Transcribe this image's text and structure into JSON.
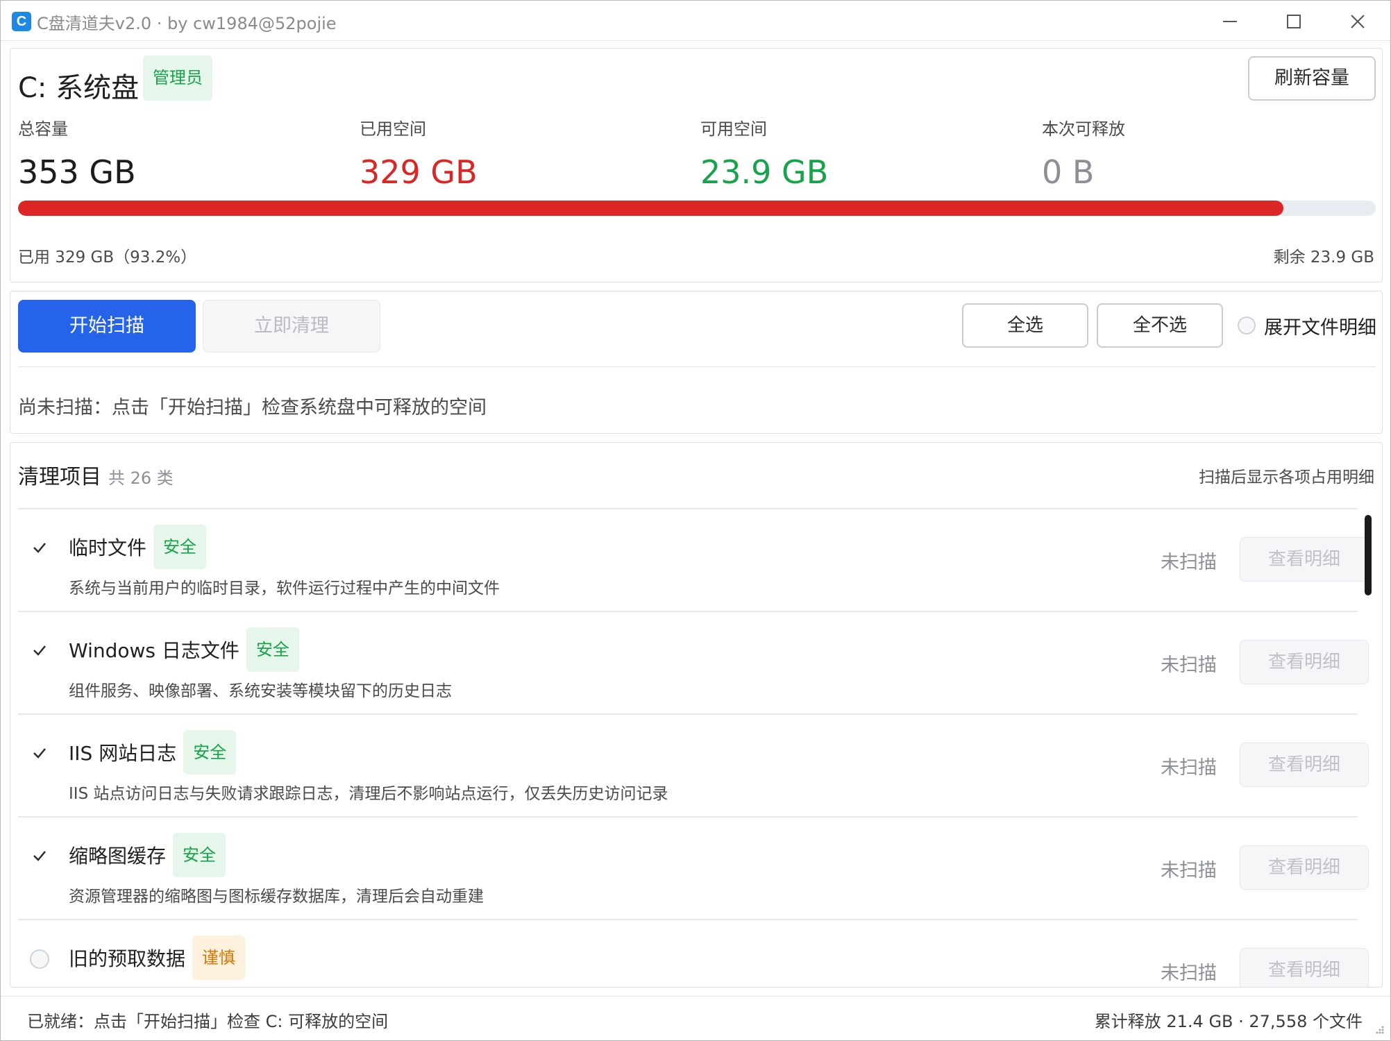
{
  "window": {
    "title": "C盘清道夫v2.0 · by cw1984@52pojie",
    "icon_letter": "C",
    "icons": [
      "app-c-icon",
      "minimize-icon",
      "maximize-icon",
      "close-icon"
    ]
  },
  "drive": {
    "title": "C: 系统盘",
    "role_badge": "管理员",
    "refresh_label": "刷新容量",
    "stats": {
      "total_label": "总容量",
      "total_value": "353 GB",
      "used_label": "已用空间",
      "used_value": "329 GB",
      "free_label": "可用空间",
      "free_value": "23.9 GB",
      "release_label": "本次可释放",
      "release_value": "0 B"
    },
    "usage_fraction": 0.932,
    "usage_left": "已用 329 GB（93.2%）",
    "usage_right": "剩余 23.9 GB"
  },
  "actions": {
    "scan_label": "开始扫描",
    "clean_label": "立即清理",
    "select_all_label": "全选",
    "select_none_label": "全不选",
    "expand_label": "展开文件明细",
    "hint": "尚未扫描：点击「开始扫描」检查系统盘中可释放的空间"
  },
  "items": {
    "title": "清理项目",
    "count": "共 26 类",
    "hint": "扫描后显示各项占用明细",
    "rows": [
      {
        "name": "临时文件",
        "badge": "安全",
        "desc": "系统与当前用户的临时目录，软件运行过程中产生的中间文件",
        "status": "未扫描",
        "detail": "查看明细"
      },
      {
        "name": "Windows 日志文件",
        "badge": "安全",
        "desc": "组件服务、映像部署、系统安装等模块留下的历史日志",
        "status": "未扫描",
        "detail": "查看明细"
      },
      {
        "name": "IIS 网站日志",
        "badge": "安全",
        "desc": "IIS 站点访问日志与失败请求跟踪日志，清理后不影响站点运行，仅丢失历史访问记录",
        "status": "未扫描",
        "detail": "查看明细"
      },
      {
        "name": "缩略图缓存",
        "badge": "安全",
        "desc": "资源管理器的缩略图与图标缓存数据库，清理后会自动重建",
        "status": "未扫描",
        "detail": "查看明细"
      },
      {
        "name": "旧的预取数据",
        "badge": "谨慎",
        "desc": "",
        "status": "未扫描",
        "detail": "查看明细"
      }
    ]
  },
  "statusbar": {
    "left": "已就绪：点击「开始扫描」检查 C: 可释放的空间",
    "right": "累计释放 21.4 GB · 27,558 个文件"
  },
  "colors": {
    "accent": "#2563eb",
    "danger": "#dc2626",
    "success": "#16a34a",
    "caution": "#d97706"
  }
}
